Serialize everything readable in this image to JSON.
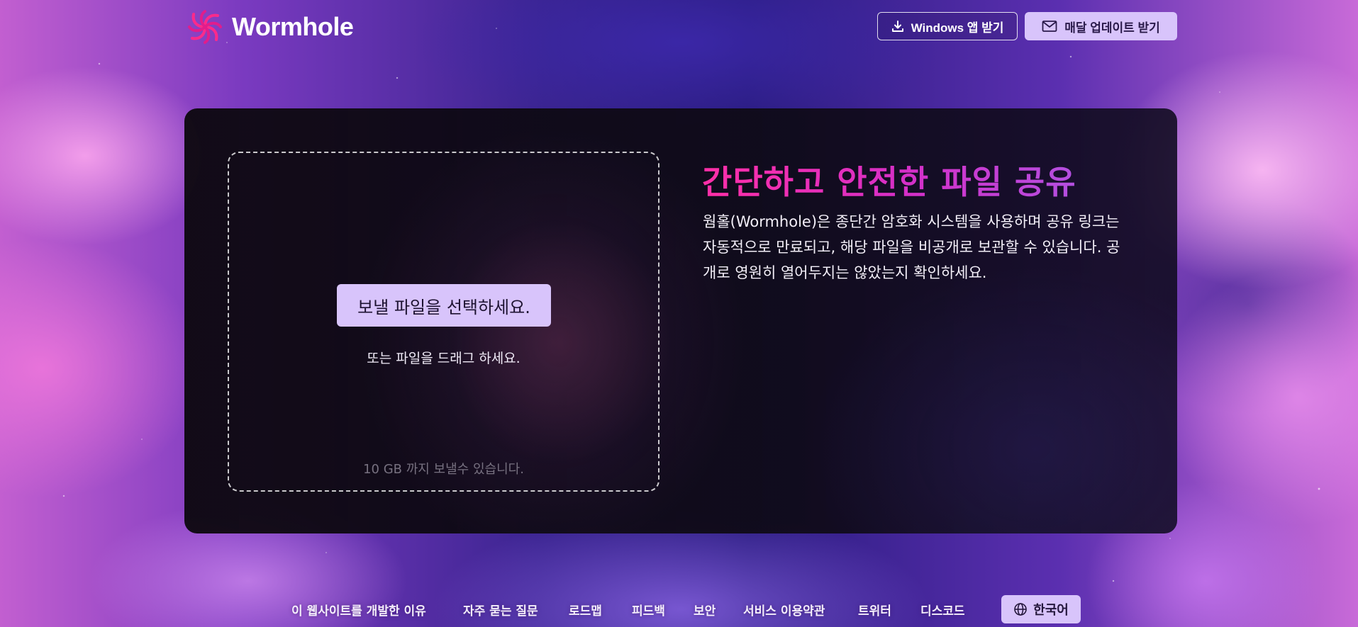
{
  "header": {
    "logo_text": "Wormhole",
    "windows_button_label": "Windows 앱 받기",
    "updates_button_label": "매달 업데이트 받기"
  },
  "main": {
    "headline": "간단하고 안전한 파일 공유",
    "description": "웜홀(Wormhole)은 종단간 암호화 시스템을 사용하며 공유 링크는 자동적으로 만료되고, 해당 파일을 비공개로 보관할 수 있습니다. 공개로 영원히 열어두지는 않았는지 확인하세요.",
    "dropzone": {
      "select_button_label": "보낼 파일을 선택하세요.",
      "drag_hint": "또는 파일을 드래그 하세요.",
      "limit_note": "10 GB 까지 보낼수 있습니다."
    }
  },
  "footer": {
    "links": [
      "이 웹사이트를 개발한 이유",
      "자주 묻는 질문",
      "로드맵",
      "피드백",
      "보안",
      "서비스 이용약관",
      "트위터",
      "디스코드"
    ],
    "language_button_label": "한국어"
  },
  "colors": {
    "accent_button": "#d8c4fb",
    "headline_gradient_start": "#ff2fa7",
    "headline_gradient_end": "#b34fe0",
    "card_background": "#0e0a14"
  }
}
